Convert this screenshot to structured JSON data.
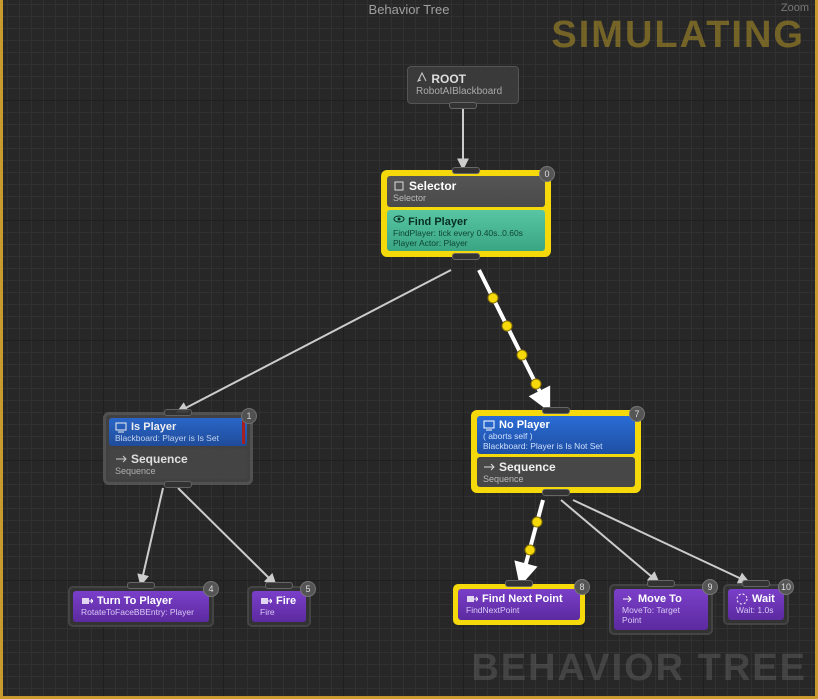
{
  "header": {
    "title": "Behavior Tree",
    "simulating": "SIMULATING",
    "watermark": "BEHAVIOR TREE",
    "zoom": "Zoom"
  },
  "root": {
    "title": "ROOT",
    "sub": "RobotAIBlackboard"
  },
  "selector": {
    "index": "0",
    "title": "Selector",
    "sub": "Selector",
    "service": {
      "title": "Find Player",
      "sub1": "FindPlayer: tick every 0.40s..0.60s",
      "sub2": "Player Actor: Player"
    }
  },
  "isPlayer": {
    "index": "1",
    "dec_title": "Is Player",
    "dec_sub": "Blackboard: Player is Is Set",
    "seq_title": "Sequence",
    "seq_sub": "Sequence"
  },
  "noPlayer": {
    "index": "7",
    "dec_title": "No Player",
    "dec_sub1": "( aborts self )",
    "dec_sub2": "Blackboard: Player is Is Not Set",
    "seq_title": "Sequence",
    "seq_sub": "Sequence"
  },
  "tasks": {
    "turn": {
      "index": "4",
      "title": "Turn To Player",
      "sub": "RotateToFaceBBEntry: Player"
    },
    "fire": {
      "index": "5",
      "title": "Fire",
      "sub": "Fire"
    },
    "find": {
      "index": "8",
      "title": "Find Next Point",
      "sub": "FindNextPoint"
    },
    "move": {
      "index": "9",
      "title": "Move To",
      "sub": "MoveTo: Target Point"
    },
    "wait": {
      "index": "10",
      "title": "Wait",
      "sub": "Wait: 1.0s"
    }
  }
}
